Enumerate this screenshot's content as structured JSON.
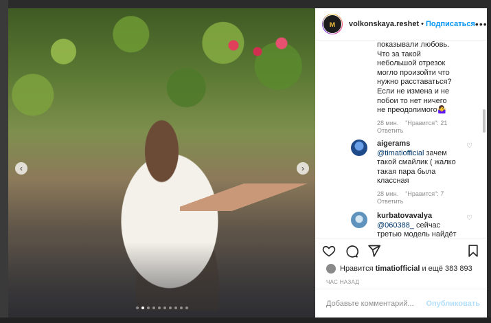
{
  "post": {
    "username": "volkonskaya.reshet",
    "header_separator": "•",
    "follow_label": "Подписаться",
    "more_label": "•••",
    "avatar_text": "ᴍ",
    "carousel": {
      "total": 10,
      "active_index": 1
    }
  },
  "comments": [
    {
      "text_lines": [
        "показывали любовь.",
        "Что за такой",
        "небольшой отрезок",
        "могло произойти что",
        "нужно расставаться?",
        "Если не измена и не",
        "побои то нет ничего",
        "не преодолимого🤷‍♀️"
      ],
      "time": "28 мин.",
      "likes": "\"Нравится\": 21",
      "reply_label": "Ответить"
    },
    {
      "username": "aigerams",
      "mention": "@timatiofficial",
      "text": " зачем такой смайлик ( жалко такая пара была классная",
      "time": "28 мин.",
      "likes": "\"Нравится\": 7",
      "reply_label": "Ответить",
      "avatar_color": "#2b5fa8"
    },
    {
      "username": "kurbatovavalya",
      "mention": "@060388_",
      "text": " сейчас третью модель найдёт",
      "avatar_color": "#7ab0d6"
    }
  ],
  "likes": {
    "prefix": "Нравится ",
    "user": "timatiofficial",
    "suffix": " и ещё 383 893"
  },
  "timestamp": "ЧАС НАЗАД",
  "add_comment": {
    "placeholder": "Добавьте комментарий...",
    "publish_label": "Опубликовать"
  }
}
